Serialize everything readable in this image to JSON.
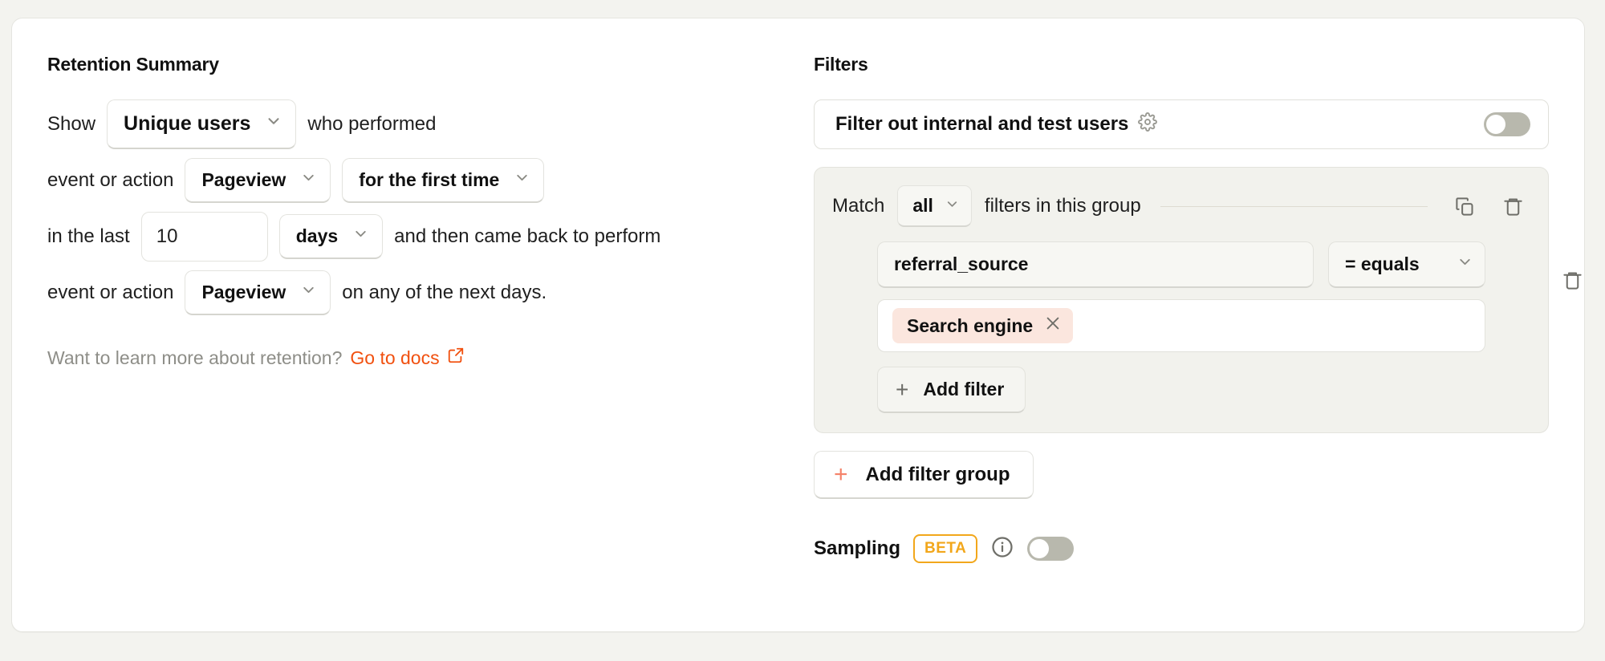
{
  "left": {
    "title": "Retention Summary",
    "row1": {
      "prefix": "Show",
      "target_entity": "Unique users",
      "suffix": "who performed"
    },
    "row2": {
      "prefix": "event or action",
      "event": "Pageview",
      "recurrence": "for the first time"
    },
    "row3": {
      "prefix": "in the last",
      "period_value": "10",
      "period_unit": "days",
      "suffix": "and then came back to perform"
    },
    "row4": {
      "prefix": "event or action",
      "event": "Pageview",
      "suffix": "on any of the next days."
    },
    "helper": {
      "text": "Want to learn more about retention?",
      "link_label": "Go to docs",
      "link_icon": "external-link-icon"
    }
  },
  "right": {
    "title": "Filters",
    "internal_filter": {
      "label": "Filter out internal and test users",
      "gear_icon": "gear-icon",
      "enabled": false
    },
    "filter_group": {
      "match_prefix": "Match",
      "match_value": "all",
      "match_suffix": "filters in this group",
      "duplicate_icon": "duplicate-icon",
      "delete_icon": "trash-icon",
      "row_delete_icon": "trash-icon",
      "property": "referral_source",
      "operator": "= equals",
      "values": [
        {
          "label": "Search engine",
          "remove_icon": "close-icon"
        }
      ],
      "add_filter_label": "Add filter",
      "add_filter_icon": "plus-icon"
    },
    "add_filter_group": {
      "label": "Add filter group",
      "icon": "plus-icon"
    },
    "sampling": {
      "label": "Sampling",
      "badge": "BETA",
      "info_icon": "info-icon",
      "enabled": false
    }
  },
  "colors": {
    "page_background": "#f3f3ef",
    "card_background": "#ffffff",
    "accent_link": "#f1500f",
    "accent_plus": "#f58269",
    "beta_badge": "#f2a71b",
    "pill_background": "#fbe6de",
    "group_background": "#f2f2ed",
    "toggle_off": "#b8b8ad"
  }
}
